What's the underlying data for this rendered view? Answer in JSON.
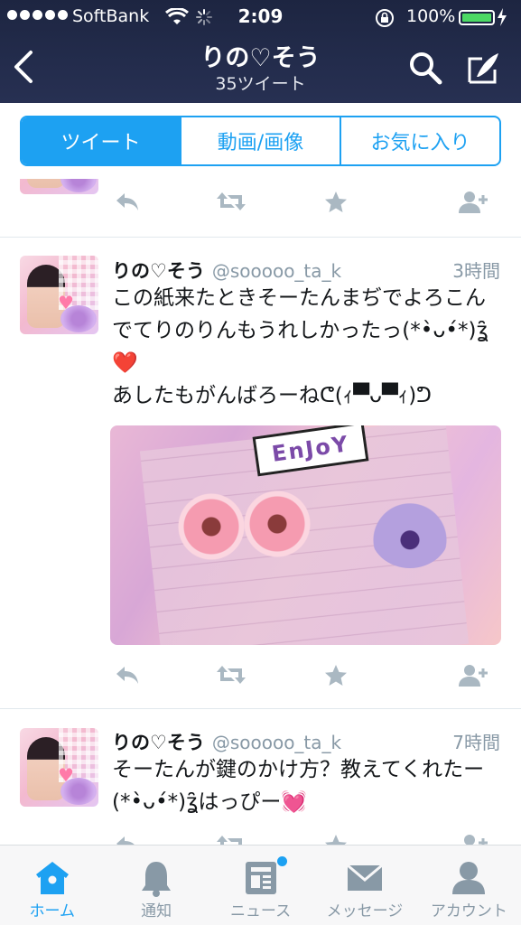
{
  "status_bar": {
    "carrier": "SoftBank",
    "time": "2:09",
    "battery_percent": "100%",
    "battery_level": 1.0
  },
  "nav": {
    "title": "りの♡そう",
    "subtitle": "35ツイート"
  },
  "segments": [
    {
      "label": "ツイート",
      "active": true
    },
    {
      "label": "動画/画像",
      "active": false
    },
    {
      "label": "お気に入り",
      "active": false
    }
  ],
  "tweets": [
    {
      "name": "りの♡そう",
      "handle": "@sooooo_ta_k",
      "time": "3時間",
      "text": "この紙来たときそーたんまぢでよろこんでてりのりんもうれしかったっ(*•̀ᴗ•́*)ʓ̑̑❤️\nあしたもがんばろーねᕦ(ｨ▀ᴗ▀ｨ)ᕤ",
      "media_text": "EnJoY"
    },
    {
      "name": "りの♡そう",
      "handle": "@sooooo_ta_k",
      "time": "7時間",
      "text": "そーたんが鍵のかけ方？教えてくれたー(*•̀ᴗ•́*)ʓ̑̑はっぴー💓"
    }
  ],
  "tabbar": [
    {
      "label": "ホーム",
      "icon": "home-icon",
      "active": true
    },
    {
      "label": "通知",
      "icon": "bell-icon",
      "active": false
    },
    {
      "label": "ニュース",
      "icon": "news-icon",
      "active": false,
      "badge": true
    },
    {
      "label": "メッセージ",
      "icon": "envelope-icon",
      "active": false
    },
    {
      "label": "アカウント",
      "icon": "person-icon",
      "active": false
    }
  ],
  "colors": {
    "accent": "#1da1f2",
    "header_bg": "#232c4c",
    "muted": "#8899a6"
  }
}
